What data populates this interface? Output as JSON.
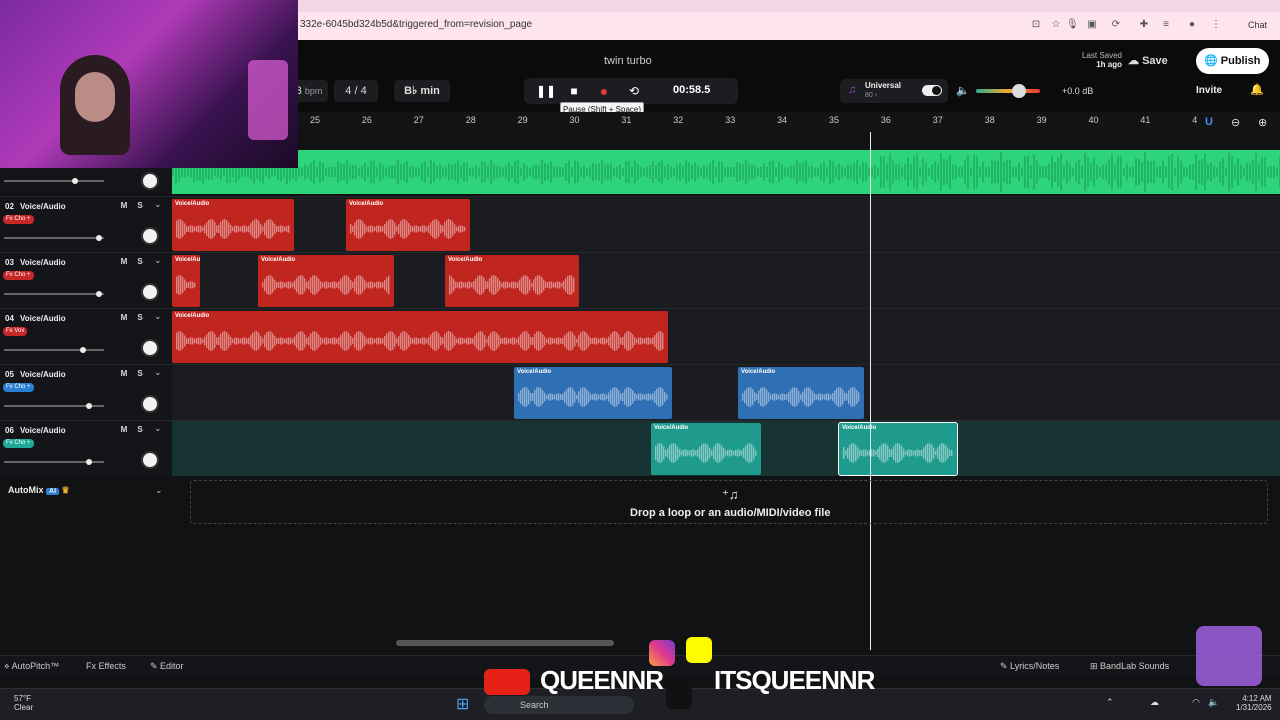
{
  "browser": {
    "url": "332e-6045bd324b5d&triggered_from=revision_page",
    "chat_label": "Chat"
  },
  "header": {
    "project_title": "twin turbo",
    "bpm_suffix": "bpm",
    "bpm_partial": "3",
    "time_signature": "4 / 4",
    "key": "B♭ min",
    "time": "00:58.5",
    "tooltip": "Pause (Shift + Space)",
    "last_saved_label": "Last Saved",
    "last_saved_value": "1h ago",
    "save_label": "Save",
    "publish_label": "Publish",
    "invite_label": "Invite",
    "universal_label": "Universal",
    "universal_sub": "80 ›",
    "volume_db": "+0.0 dB"
  },
  "ruler": [
    "25",
    "26",
    "27",
    "28",
    "29",
    "30",
    "31",
    "32",
    "33",
    "34",
    "35",
    "36",
    "37",
    "38",
    "39",
    "40",
    "41",
    "4"
  ],
  "tracks": [
    {
      "number": "02",
      "name": "Voice/Audio",
      "fx": "Fx Cho +",
      "fx_color": "#c62828"
    },
    {
      "number": "03",
      "name": "Voice/Audio",
      "fx": "Fx Cho +",
      "fx_color": "#c62828"
    },
    {
      "number": "04",
      "name": "Voice/Audio",
      "fx": "Fx Vox",
      "fx_color": "#c62828"
    },
    {
      "number": "05",
      "name": "Voice/Audio",
      "fx": "Fx Cho +",
      "fx_color": "#2a7fd4"
    },
    {
      "number": "06",
      "name": "Voice/Audio",
      "fx": "Fx Cho +",
      "fx_color": "#1fa89a"
    }
  ],
  "mute_label": "M",
  "solo_label": "S",
  "clip_label": "Voice/Audio",
  "automix": {
    "label": "AutoMix",
    "badge": "AI"
  },
  "drop_text": "Drop a loop or an audio/MIDI/video file",
  "bottom": {
    "autopitch": "AutoPitch™",
    "effects": "Effects",
    "editor": "Editor",
    "lyrics": "Lyrics/Notes",
    "sounds": "BandLab Sounds"
  },
  "overlay": {
    "handle1": "QUEENNR",
    "handle2": "ITSQUEENNR"
  },
  "taskbar": {
    "temp": "57°F",
    "weather": "Clear",
    "search": "Search",
    "time": "4:12 AM",
    "date": "1/31/2026"
  },
  "colors": {
    "red_clip": "#c0261f",
    "blue_clip": "#2f6fb3",
    "teal_clip": "#1f9b8e",
    "green_track": "#2ed47a"
  }
}
